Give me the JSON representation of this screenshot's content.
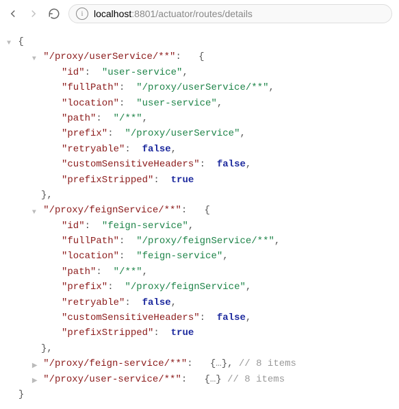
{
  "url": {
    "host": "localhost",
    "rest": ":8801/actuator/routes/details"
  },
  "route1": {
    "key": "\"/proxy/userService/**\"",
    "id": {
      "k": "\"id\"",
      "v": "\"user-service\""
    },
    "fullPath": {
      "k": "\"fullPath\"",
      "v": "\"/proxy/userService/**\""
    },
    "location": {
      "k": "\"location\"",
      "v": "\"user-service\""
    },
    "path": {
      "k": "\"path\"",
      "v": "\"/**\""
    },
    "prefix": {
      "k": "\"prefix\"",
      "v": "\"/proxy/userService\""
    },
    "retryable": {
      "k": "\"retryable\"",
      "v": "false"
    },
    "csh": {
      "k": "\"customSensitiveHeaders\"",
      "v": "false"
    },
    "ps": {
      "k": "\"prefixStripped\"",
      "v": "true"
    }
  },
  "route2": {
    "key": "\"/proxy/feignService/**\"",
    "id": {
      "k": "\"id\"",
      "v": "\"feign-service\""
    },
    "fullPath": {
      "k": "\"fullPath\"",
      "v": "\"/proxy/feignService/**\""
    },
    "location": {
      "k": "\"location\"",
      "v": "\"feign-service\""
    },
    "path": {
      "k": "\"path\"",
      "v": "\"/**\""
    },
    "prefix": {
      "k": "\"prefix\"",
      "v": "\"/proxy/feignService\""
    },
    "retryable": {
      "k": "\"retryable\"",
      "v": "false"
    },
    "csh": {
      "k": "\"customSensitiveHeaders\"",
      "v": "false"
    },
    "ps": {
      "k": "\"prefixStripped\"",
      "v": "true"
    }
  },
  "collapsed1": {
    "key": "\"/proxy/feign-service/**\"",
    "items": "// 8 items"
  },
  "collapsed2": {
    "key": "\"/proxy/user-service/**\"",
    "items": "// 8 items"
  },
  "ellipsis": "…",
  "pun": {
    "open": "{",
    "close": "}",
    "colon": ":",
    "comma": ","
  }
}
